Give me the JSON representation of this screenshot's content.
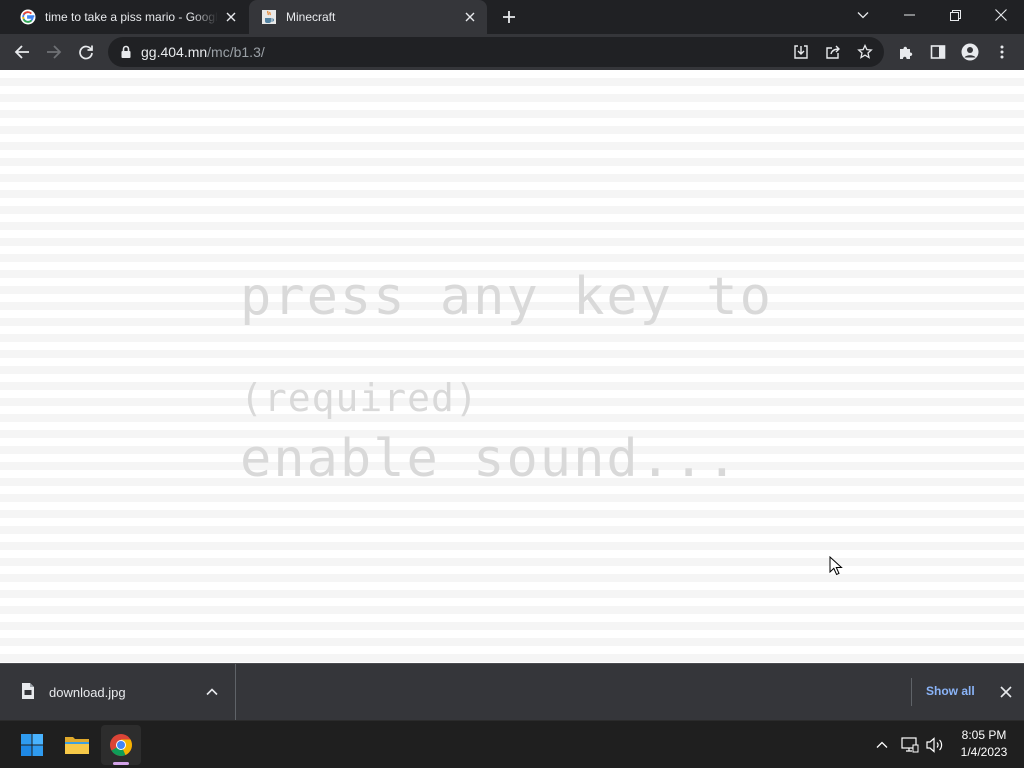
{
  "browser": {
    "tabs": [
      {
        "title": "time to take a piss mario - Google Search",
        "favicon": "google-g-icon",
        "active": false
      },
      {
        "title": "Minecraft",
        "favicon": "java-cup-icon",
        "active": true
      }
    ],
    "window_controls": [
      "tab-search-icon",
      "minimize-icon",
      "restore-icon",
      "close-icon"
    ],
    "toolbar": {
      "url_host": "gg.404.mn",
      "url_path": "/mc/b1.3/",
      "icons": [
        "back-arrow-icon",
        "forward-arrow-icon",
        "reload-icon",
        "lock-icon",
        "install-app-icon",
        "share-icon",
        "bookmark-star-icon",
        "extensions-icon",
        "side-panel-icon",
        "profile-icon",
        "kebab-menu-icon"
      ]
    }
  },
  "page": {
    "press_line_1": "press any key to",
    "press_line_2": "enable sound...",
    "required": "(required)"
  },
  "download_shelf": {
    "file_name": "download.jpg",
    "show_all": "Show all"
  },
  "taskbar": {
    "apps": [
      "windows-start-icon",
      "file-explorer-icon",
      "chrome-icon"
    ],
    "tray_icons": [
      "chevron-up-icon",
      "network-icon",
      "volume-icon"
    ],
    "time": "8:05 PM",
    "date": "1/4/2023"
  },
  "colors": {
    "tab_strip": "#202124",
    "toolbar": "#35363a",
    "link_blue": "#8ab4f8",
    "page_text_gray": "#d9d9d9"
  }
}
